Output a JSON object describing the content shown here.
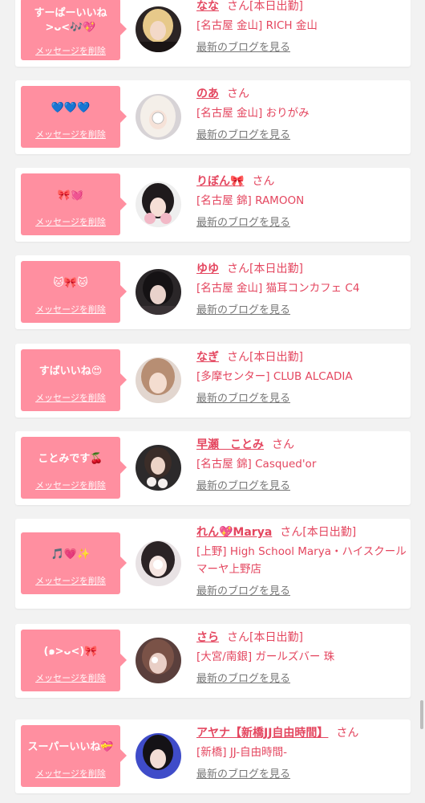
{
  "delete_label": "メッセージを削除",
  "san_label": "さん",
  "blog_label": "最新のブログを見る",
  "accent_color": "#e4465f",
  "message_box_color": "#ff8fa0",
  "items": [
    {
      "message_line1": "すーぱーいいね",
      "message_line2": ">ᴗ<🎶💖",
      "name": "なな",
      "status": "[本日出勤]",
      "shop": "[名古屋 金山] RICH 金山",
      "blog": "最新のブログを見る"
    },
    {
      "message_line1": "💙💙💙",
      "message_line2": "",
      "name": "のあ",
      "status": "",
      "shop": "[名古屋 金山] おりがみ",
      "blog": "最新のブログを見る"
    },
    {
      "message_line1": "🎀💓",
      "message_line2": "",
      "name": "りぼん🎀",
      "status": "",
      "shop": "[名古屋 錦] RAMOON",
      "blog": "最新のブログを見る"
    },
    {
      "message_line1": "🐱🎀🐱",
      "message_line2": "",
      "name": "ゆゆ",
      "status": "[本日出勤]",
      "shop": "[名古屋 金山] 猫耳コンカフェ C4",
      "blog": "最新のブログを見る"
    },
    {
      "message_line1": "すばいいね😍",
      "message_line2": "",
      "name": "なぎ",
      "status": "[本日出勤]",
      "shop": "[多摩センター] CLUB ALCADIA",
      "blog": "最新のブログを見る"
    },
    {
      "message_line1": "ことみです🍒",
      "message_line2": "",
      "name": "早瀬　ことみ",
      "status": "",
      "shop": "[名古屋 錦] Casqued'or",
      "blog": "最新のブログを見る"
    },
    {
      "message_line1": "🎵💗✨",
      "message_line2": "",
      "name": "れん💖Marya",
      "status": "[本日出勤]",
      "shop": "[上野] High School Marya・ハイスクールマーヤ上野店",
      "blog": "最新のブログを見る"
    },
    {
      "message_line1": "(๑>ᴗ<)🎀",
      "message_line2": "",
      "name": "さら",
      "status": "[本日出勤]",
      "shop": "[大宮/南銀] ガールズバー 珠",
      "blog": "最新のブログを見る"
    },
    {
      "message_line1": "スーパーいいね💝",
      "message_line2": "",
      "name": "アヤナ【新橋JJ自由時間】",
      "status": "",
      "shop": "[新橋] JJ-自由時間-",
      "blog": "最新のブログを見る"
    }
  ]
}
